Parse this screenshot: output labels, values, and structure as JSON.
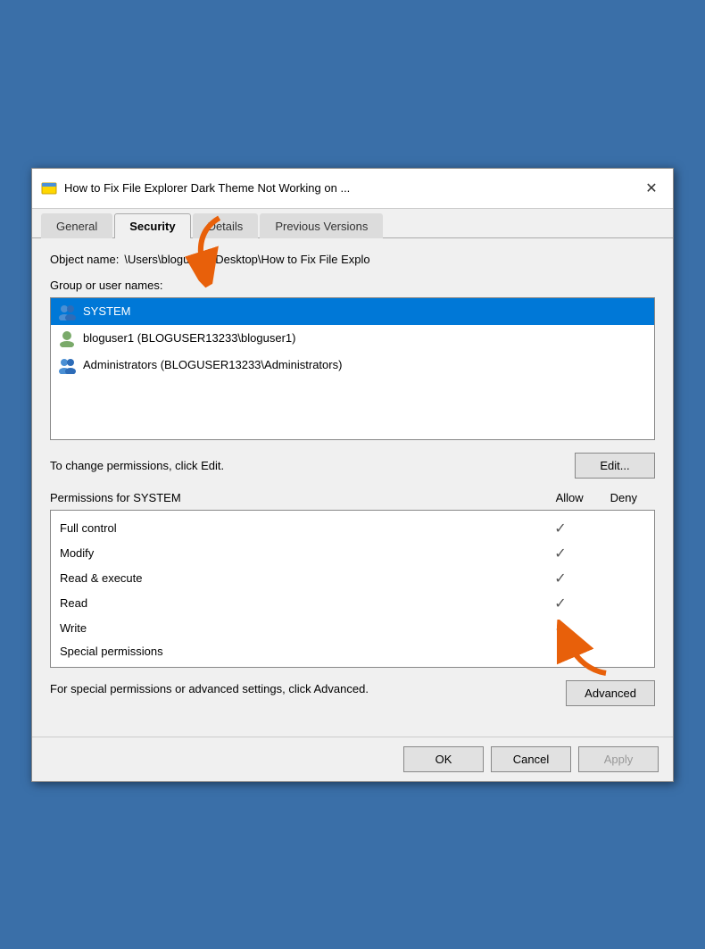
{
  "titleBar": {
    "title": "How to Fix File Explorer Dark Theme Not Working on ...",
    "closeLabel": "✕"
  },
  "tabs": [
    {
      "label": "General",
      "active": false
    },
    {
      "label": "Security",
      "active": true
    },
    {
      "label": "Details",
      "active": false
    },
    {
      "label": "Previous Versions",
      "active": false
    }
  ],
  "objectName": {
    "label": "Object name:",
    "value": "\\Users\\bloguser1\\Desktop\\How to Fix File Explo"
  },
  "groupSection": {
    "label": "Group or user names:",
    "users": [
      {
        "name": "SYSTEM",
        "selected": true
      },
      {
        "name": "bloguser1 (BLOGUSER13233\\bloguser1)",
        "selected": false
      },
      {
        "name": "Administrators (BLOGUSER13233\\Administrators)",
        "selected": false
      }
    ]
  },
  "changePerms": {
    "text": "To change permissions, click Edit.",
    "editButton": "Edit..."
  },
  "permissions": {
    "title": "Permissions for SYSTEM",
    "allowLabel": "Allow",
    "denyLabel": "Deny",
    "rows": [
      {
        "name": "Full control",
        "allow": true,
        "deny": false
      },
      {
        "name": "Modify",
        "allow": true,
        "deny": false
      },
      {
        "name": "Read & execute",
        "allow": true,
        "deny": false
      },
      {
        "name": "Read",
        "allow": true,
        "deny": false
      },
      {
        "name": "Write",
        "allow": true,
        "deny": false
      },
      {
        "name": "Special permissions",
        "allow": false,
        "deny": false
      }
    ]
  },
  "advancedSection": {
    "text": "For special permissions or advanced settings, click Advanced.",
    "button": "Advanced"
  },
  "bottomButtons": {
    "ok": "OK",
    "cancel": "Cancel",
    "apply": "Apply"
  }
}
